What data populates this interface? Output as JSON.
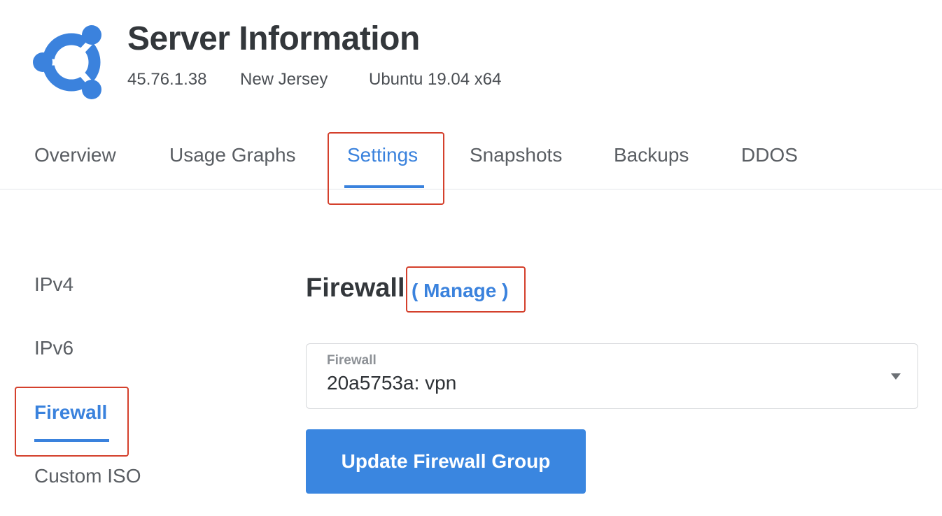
{
  "header": {
    "title": "Server Information",
    "ip": "45.76.1.38",
    "location": "New Jersey",
    "os": "Ubuntu 19.04 x64",
    "logo_icon": "ubuntu-logo-icon",
    "logo_color": "#3b82dd"
  },
  "tabs": [
    {
      "label": "Overview",
      "active": false
    },
    {
      "label": "Usage Graphs",
      "active": false
    },
    {
      "label": "Settings",
      "active": true
    },
    {
      "label": "Snapshots",
      "active": false
    },
    {
      "label": "Backups",
      "active": false
    },
    {
      "label": "DDOS",
      "active": false
    }
  ],
  "sidebar": {
    "items": [
      {
        "label": "IPv4",
        "active": false
      },
      {
        "label": "IPv6",
        "active": false
      },
      {
        "label": "Firewall",
        "active": true
      },
      {
        "label": "Custom ISO",
        "active": false
      }
    ]
  },
  "main": {
    "section_title": "Firewall",
    "manage_link": "( Manage )",
    "select": {
      "label": "Firewall",
      "value": "20a5753a: vpn",
      "caret_icon": "caret-down-icon"
    },
    "update_button": "Update Firewall Group"
  },
  "colors": {
    "accent": "#3a82dd",
    "highlight_box": "#d4402c",
    "button_bg": "#3a86e0"
  }
}
